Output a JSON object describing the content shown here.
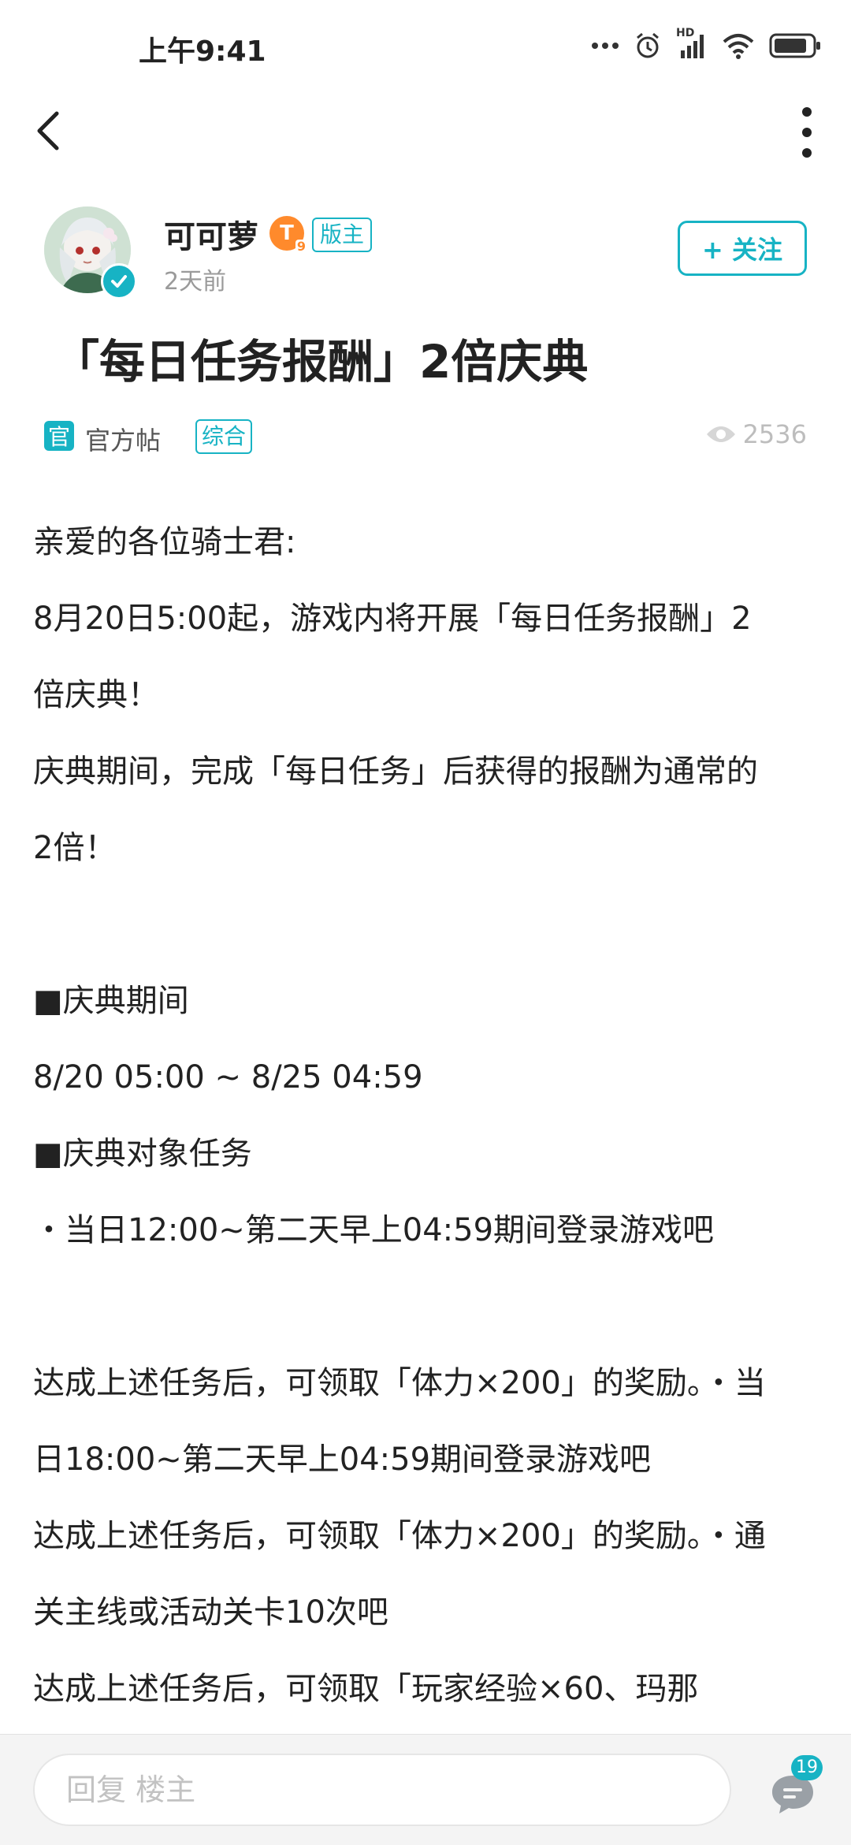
{
  "status_bar": {
    "time": "上午9:41",
    "network_label": "HD"
  },
  "author": {
    "name": "可可萝",
    "level": "T",
    "level_sub": "9",
    "role": "版主",
    "posted": "2天前"
  },
  "follow_label": "+ 关注",
  "post": {
    "title": "「每日任务报酬」2倍庆典",
    "official_icon": "官",
    "official_label": "官方帖",
    "topic_tag": "综合",
    "views": "2536"
  },
  "content": {
    "p1": "亲爱的各位骑士君:",
    "p2": "8月20日5:00起，游戏内将开展「每日任务报酬」2",
    "p3": "倍庆典！",
    "p4": "庆典期间，完成「每日任务」后获得的报酬为通常的",
    "p5": "2倍！",
    "p6": "■庆典期间",
    "p7": "8/20 05:00 ~ 8/25 04:59",
    "p8": "■庆典对象任务",
    "p9": "・当日12:00~第二天早上04:59期间登录游戏吧",
    "p10": "达成上述任务后，可领取「体力×200」的奖励。・当",
    "p11": "日18:00~第二天早上04:59期间登录游戏吧",
    "p12": "达成上述任务后，可领取「体力×200」的奖励。・通",
    "p13": "关主线或活动关卡10次吧",
    "p14": "达成上述任务后，可领取「玩家经验×60、玛那"
  },
  "bottom_bar": {
    "reply_placeholder": "回复  楼主",
    "comment_count": "19"
  },
  "colors": {
    "accent": "#17b3c4",
    "level_badge": "#ff8a2c",
    "muted_text": "#9a9a9a"
  },
  "icons": [
    "back-arrow-icon",
    "more-vertical-icon",
    "verified-icon",
    "eye-icon",
    "comment-icon",
    "alarm-icon",
    "signal-icon",
    "wifi-icon",
    "battery-icon"
  ]
}
